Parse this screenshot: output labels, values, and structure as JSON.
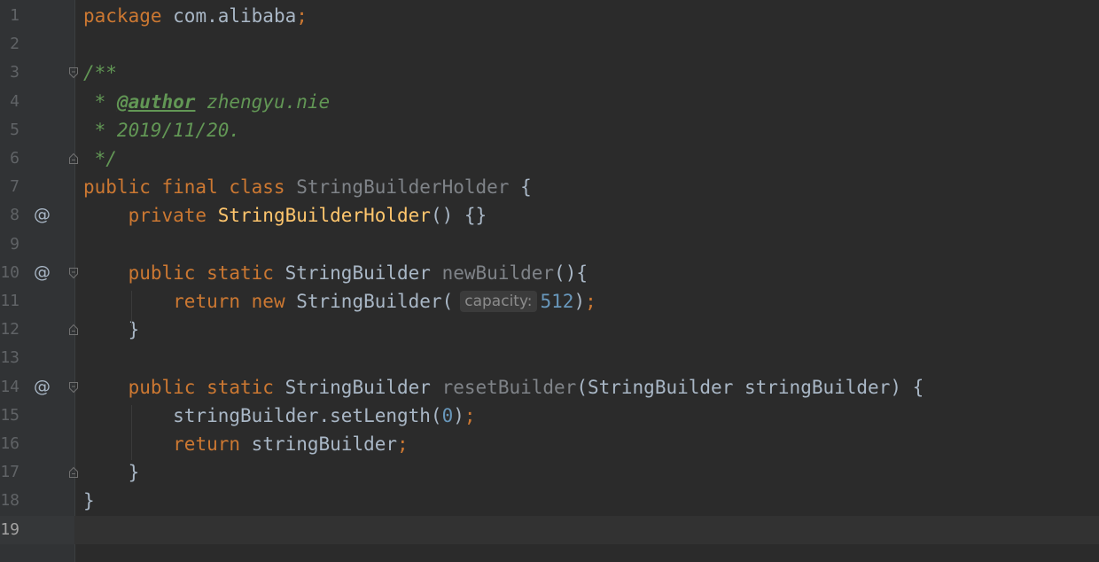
{
  "editor": {
    "lines": [
      {
        "n": "1",
        "marker": "",
        "fold": "",
        "tokens": [
          [
            "kw",
            "package"
          ],
          [
            "p",
            " com.alibaba"
          ],
          [
            "kw",
            ";"
          ]
        ]
      },
      {
        "n": "2",
        "marker": "",
        "fold": "",
        "tokens": []
      },
      {
        "n": "3",
        "marker": "",
        "fold": "start",
        "tokens": [
          [
            "cmt",
            "/**"
          ]
        ]
      },
      {
        "n": "4",
        "marker": "",
        "fold": "",
        "tokens": [
          [
            "cmt",
            " * "
          ],
          [
            "tag",
            "@author"
          ],
          [
            "cmt",
            " zhengyu.nie"
          ]
        ]
      },
      {
        "n": "5",
        "marker": "",
        "fold": "",
        "tokens": [
          [
            "cmt",
            " * 2019/11/20."
          ]
        ]
      },
      {
        "n": "6",
        "marker": "",
        "fold": "end",
        "tokens": [
          [
            "cmt",
            " */"
          ]
        ]
      },
      {
        "n": "7",
        "marker": "",
        "fold": "",
        "tokens": [
          [
            "kw",
            "public final class "
          ],
          [
            "gray",
            "StringBuilderHolder"
          ],
          [
            "p",
            " {"
          ]
        ]
      },
      {
        "n": "8",
        "marker": "@",
        "fold": "",
        "tokens": [
          [
            "p",
            "    "
          ],
          [
            "kw",
            "private "
          ],
          [
            "fn",
            "StringBuilderHolder"
          ],
          [
            "p",
            "() {}"
          ]
        ]
      },
      {
        "n": "9",
        "marker": "",
        "fold": "",
        "tokens": []
      },
      {
        "n": "10",
        "marker": "@",
        "fold": "start",
        "tokens": [
          [
            "p",
            "    "
          ],
          [
            "kw",
            "public static "
          ],
          [
            "p",
            "StringBuilder "
          ],
          [
            "gray",
            "newBuilder"
          ],
          [
            "p",
            "(){"
          ]
        ]
      },
      {
        "n": "11",
        "marker": "",
        "fold": "",
        "tokens": [
          [
            "p",
            "        "
          ],
          [
            "kw",
            "return new "
          ],
          [
            "p",
            "StringBuilder("
          ],
          [
            "hint",
            "capacity:"
          ],
          [
            "num",
            "512"
          ],
          [
            "p",
            ")"
          ],
          [
            "kw",
            ";"
          ]
        ]
      },
      {
        "n": "12",
        "marker": "",
        "fold": "end",
        "tokens": [
          [
            "p",
            "    }"
          ]
        ]
      },
      {
        "n": "13",
        "marker": "",
        "fold": "",
        "tokens": []
      },
      {
        "n": "14",
        "marker": "@",
        "fold": "start",
        "tokens": [
          [
            "p",
            "    "
          ],
          [
            "kw",
            "public static "
          ],
          [
            "p",
            "StringBuilder "
          ],
          [
            "gray",
            "resetBuilder"
          ],
          [
            "p",
            "(StringBuilder stringBuilder) {"
          ]
        ]
      },
      {
        "n": "15",
        "marker": "",
        "fold": "",
        "tokens": [
          [
            "p",
            "        stringBuilder.setLength("
          ],
          [
            "num",
            "0"
          ],
          [
            "p",
            ")"
          ],
          [
            "kw",
            ";"
          ]
        ]
      },
      {
        "n": "16",
        "marker": "",
        "fold": "",
        "tokens": [
          [
            "p",
            "        "
          ],
          [
            "kw",
            "return "
          ],
          [
            "p",
            "stringBuilder"
          ],
          [
            "kw",
            ";"
          ]
        ]
      },
      {
        "n": "17",
        "marker": "",
        "fold": "end",
        "tokens": [
          [
            "p",
            "    }"
          ]
        ]
      },
      {
        "n": "18",
        "marker": "",
        "fold": "",
        "tokens": [
          [
            "p",
            "}"
          ]
        ]
      },
      {
        "n": "19",
        "marker": "",
        "fold": "",
        "tokens": [],
        "current": true
      }
    ]
  },
  "colors": {
    "background": "#2b2b2b",
    "gutter": "#313335",
    "keyword": "#cc7832",
    "comment": "#629755",
    "number": "#6897bb",
    "function_decl": "#ffc66d",
    "plain": "#a9b7c6"
  }
}
